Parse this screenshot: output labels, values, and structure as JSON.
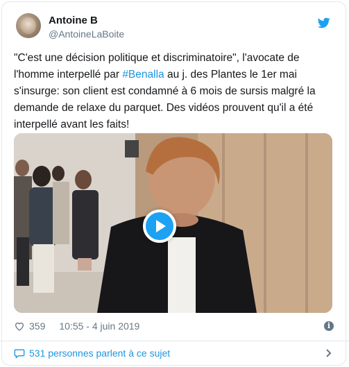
{
  "author": {
    "name": "Antoine B",
    "handle": "@AntoineLaBoite"
  },
  "tweet": {
    "text_before": "\"C'est une décision politique et discriminatoire\", l'avocate de l'homme interpellé par ",
    "hashtag": "#Benalla",
    "text_after": " au j. des Plantes le 1er mai s'insurge: son client est condamné à 6 mois de sursis malgré la demande de relaxe du parquet. Des vidéos prouvent qu'il a été interpellé avant les faits!"
  },
  "meta": {
    "likes": "359",
    "timestamp": "10:55 - 4 juin 2019"
  },
  "footer": {
    "conversation": "531 personnes parlent à ce sujet"
  },
  "colors": {
    "accent": "#1da1f2",
    "link": "#1b95e0",
    "muted": "#657786"
  },
  "icons": [
    "twitter-bird-icon",
    "play-icon",
    "heart-icon",
    "info-icon",
    "speech-bubble-icon",
    "chevron-right-icon"
  ]
}
